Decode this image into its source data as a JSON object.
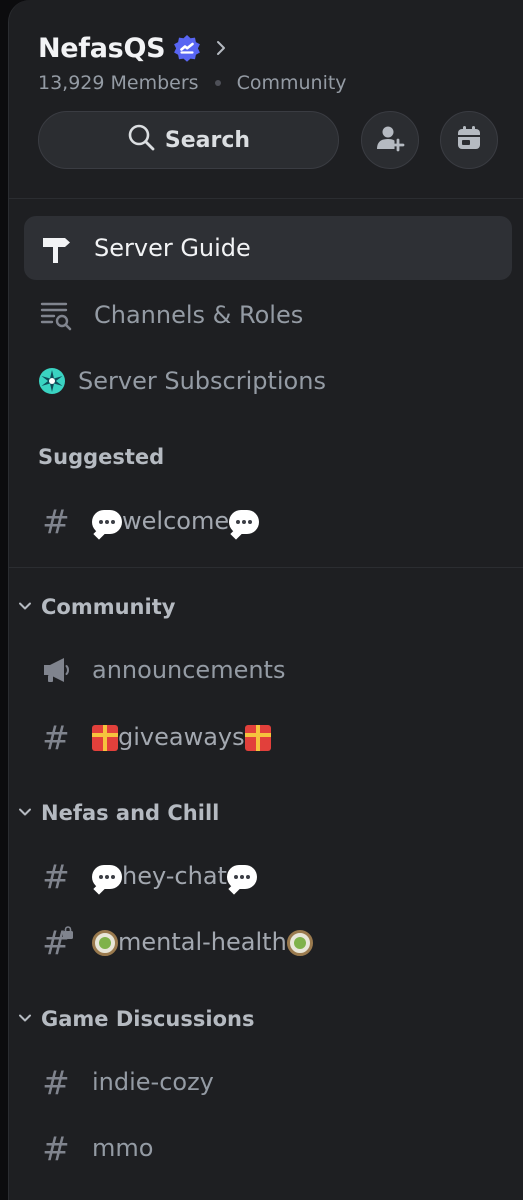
{
  "server": {
    "name": "NefasQS",
    "members": "13,929 Members",
    "type": "Community"
  },
  "search": {
    "label": "Search"
  },
  "icons": {
    "verified": "verified-badge-icon",
    "chevron": "chevron-right-icon",
    "search": "search-icon",
    "invite": "add-member-icon",
    "events": "calendar-icon"
  },
  "colors": {
    "background": "#1e1f22",
    "active_row": "#2e3035",
    "text_primary": "#f2f3f5",
    "text_muted": "#949ba4",
    "verified": "#5865f2",
    "subscription": "#3ad3c2"
  },
  "nav": {
    "server_guide": "Server Guide",
    "channels_roles": "Channels & Roles",
    "server_subscriptions": "Server Subscriptions"
  },
  "suggested": {
    "title": "Suggested",
    "channels": [
      {
        "name": "welcome",
        "emoji": "speech-bubble"
      }
    ]
  },
  "categories": [
    {
      "name": "Community",
      "channels": [
        {
          "name": "announcements",
          "icon": "megaphone-icon"
        },
        {
          "name": "giveaways",
          "emoji": "gift"
        }
      ]
    },
    {
      "name": "Nefas and Chill",
      "channels": [
        {
          "name": "hey-chat",
          "emoji": "speech-bubble"
        },
        {
          "name": "mental-health",
          "emoji": "tea",
          "locked": true
        }
      ]
    },
    {
      "name": "Game Discussions",
      "channels": [
        {
          "name": "indie-cozy"
        },
        {
          "name": "mmo"
        }
      ]
    }
  ]
}
